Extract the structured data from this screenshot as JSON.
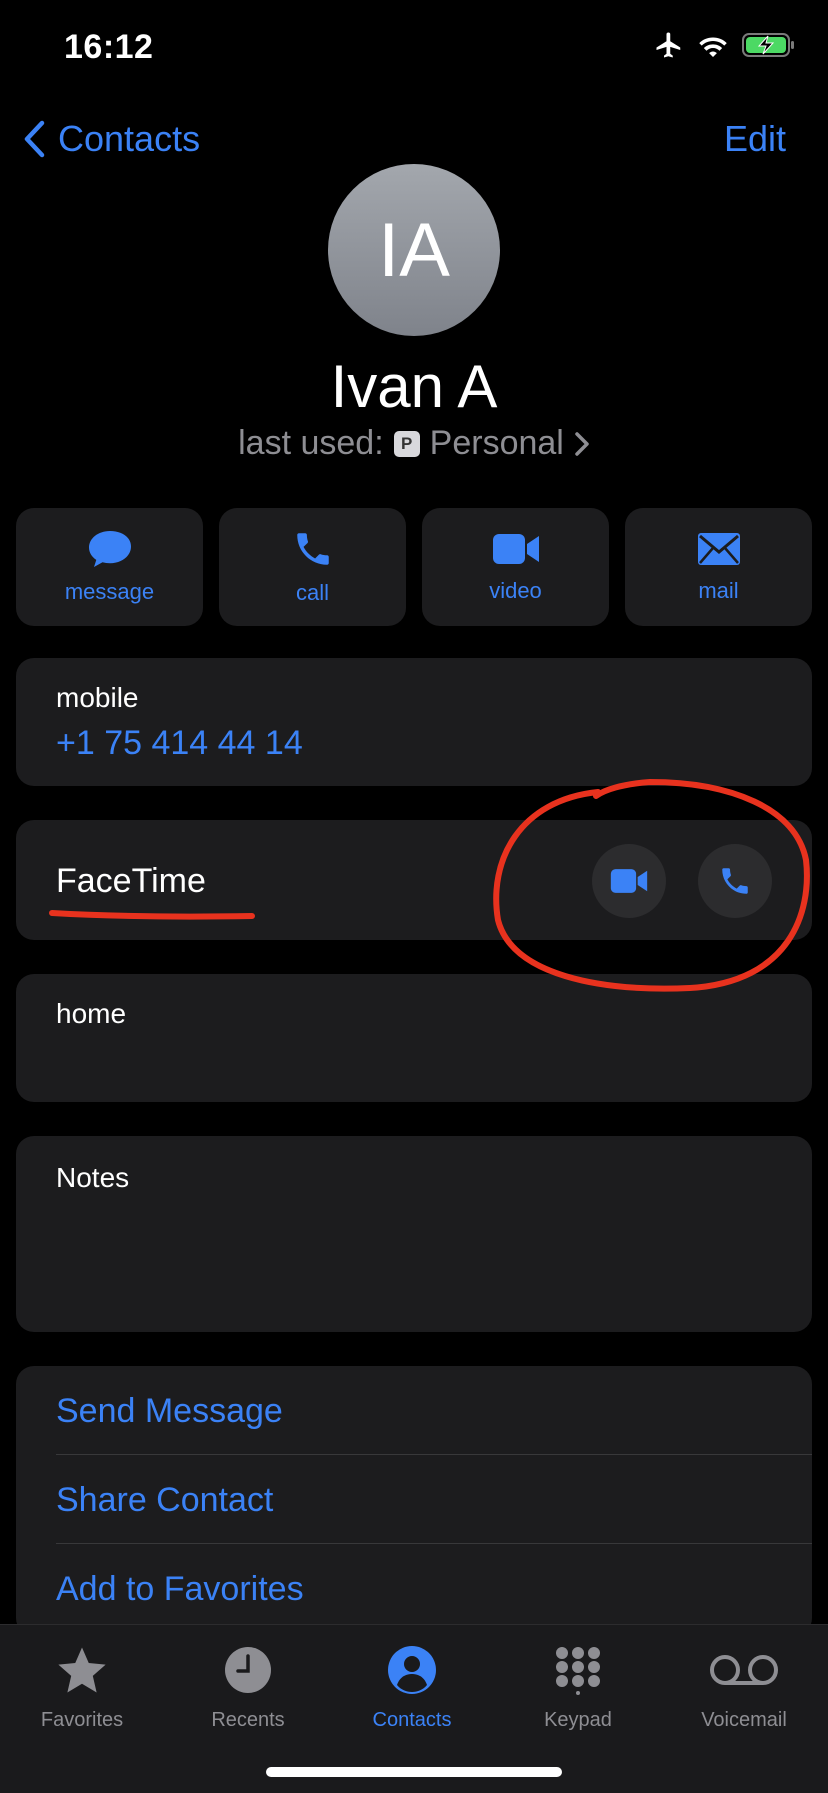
{
  "status": {
    "time": "16:12",
    "icons": [
      "airplane-icon",
      "wifi-icon",
      "battery-charging-icon"
    ]
  },
  "nav": {
    "back_label": "Contacts",
    "edit_label": "Edit"
  },
  "contact": {
    "initials": "IA",
    "name": "Ivan A",
    "last_used_prefix": "last used:",
    "last_used_badge": "P",
    "last_used_value": "Personal"
  },
  "actions": [
    {
      "label": "message",
      "icon": "message-bubble-icon"
    },
    {
      "label": "call",
      "icon": "phone-icon"
    },
    {
      "label": "video",
      "icon": "video-camera-icon"
    },
    {
      "label": "mail",
      "icon": "envelope-icon"
    }
  ],
  "mobile": {
    "label": "mobile",
    "number": "+1 75 414 44 14"
  },
  "facetime": {
    "label": "FaceTime"
  },
  "home": {
    "label": "home"
  },
  "notes": {
    "label": "Notes"
  },
  "links": [
    "Send Message",
    "Share Contact",
    "Add to Favorites"
  ],
  "tabs": [
    {
      "label": "Favorites",
      "icon": "star-icon",
      "active": false
    },
    {
      "label": "Recents",
      "icon": "clock-icon",
      "active": false
    },
    {
      "label": "Contacts",
      "icon": "person-circle-icon",
      "active": true
    },
    {
      "label": "Keypad",
      "icon": "keypad-icon",
      "active": false
    },
    {
      "label": "Voicemail",
      "icon": "voicemail-icon",
      "active": false
    }
  ],
  "colors": {
    "accent": "#3b82f6",
    "card": "#1c1c1e",
    "annotation": "#e8321e"
  }
}
